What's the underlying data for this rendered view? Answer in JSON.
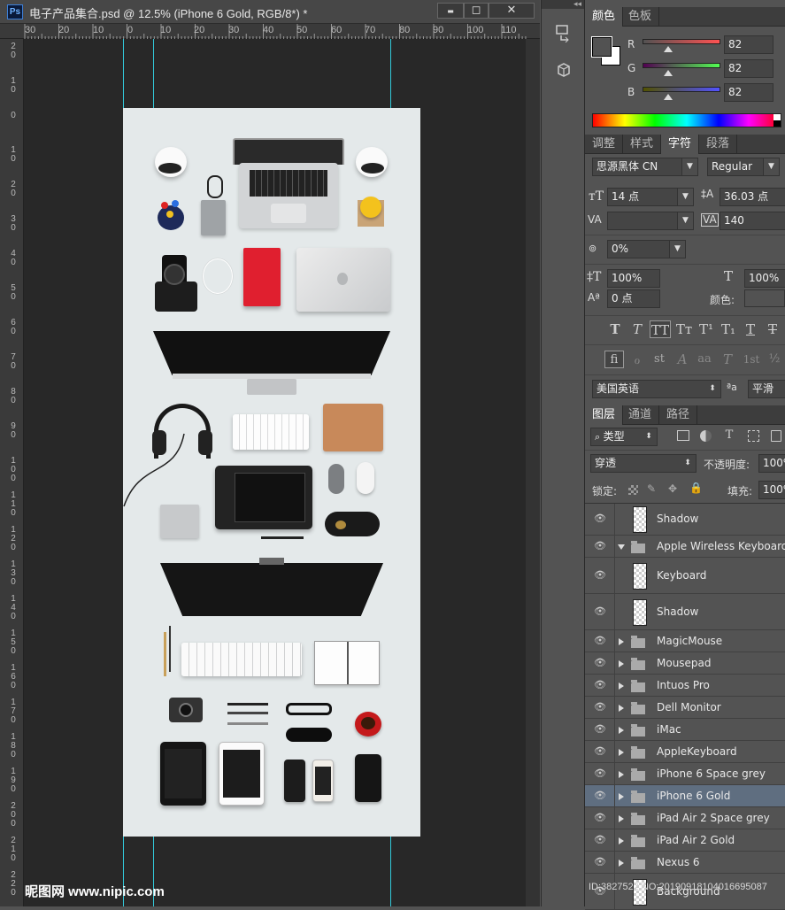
{
  "document": {
    "app_badge": "Ps",
    "title": "电子产品集合.psd @ 12.5% (iPhone 6 Gold, RGB/8*) *",
    "minimize": "▬",
    "maximize": "◻",
    "close": "✕"
  },
  "ruler_top": [
    "30",
    "20",
    "10",
    "0",
    "10",
    "20",
    "30",
    "40",
    "50",
    "60",
    "70",
    "80",
    "90",
    "100",
    "110"
  ],
  "ruler_left": [
    "20",
    "10",
    "0",
    "10",
    "20",
    "30",
    "40",
    "50",
    "60",
    "70",
    "80",
    "90",
    "100",
    "110",
    "120",
    "130",
    "140",
    "150",
    "160",
    "170",
    "180",
    "190",
    "200",
    "210",
    "220"
  ],
  "watermark": {
    "logo": "昵图网 www.nipic.com",
    "id": "ID:3827522 NO:20190918104016695087"
  },
  "color_panel": {
    "tabs": [
      "颜色",
      "色板"
    ],
    "active_tab": 0,
    "channels": [
      {
        "label": "R",
        "value": "82"
      },
      {
        "label": "G",
        "value": "82"
      },
      {
        "label": "B",
        "value": "82"
      }
    ],
    "foreground": "#525252",
    "background": "#ffffff"
  },
  "character_panel": {
    "tabs": [
      "调整",
      "样式",
      "字符",
      "段落"
    ],
    "active_tab": 2,
    "font_family": "思源黑体 CN",
    "font_style": "Regular",
    "font_size": "14 点",
    "leading": "36.03 点",
    "kerning": "",
    "tracking": "140",
    "tsume": "0%",
    "vertical_scale": "100%",
    "horizontal_scale": "100%",
    "baseline_shift": "0 点",
    "color_label": "颜色:",
    "language": "美国英语",
    "aa_label": "ªa",
    "antialias": "平滑",
    "style_buttons": [
      "T",
      "T",
      "TT",
      "Tт",
      "T¹",
      "T₁",
      "T",
      "T"
    ],
    "opentype_buttons": [
      "fi",
      "ℴ",
      "st",
      "A",
      "aa",
      "T",
      "1st",
      "½"
    ]
  },
  "layers_panel": {
    "tabs": [
      "图层",
      "通道",
      "路径"
    ],
    "active_tab": 0,
    "filter_kind": "类型",
    "blend_mode": "穿透",
    "opacity_label": "不透明度:",
    "opacity": "100%",
    "lock_label": "锁定:",
    "fill_label": "填充:",
    "fill": "100%",
    "layers": [
      {
        "name": "Shadow",
        "type": "pixel",
        "indent": 1,
        "selected": false
      },
      {
        "name": "Apple Wireless Keyboard",
        "type": "group-open",
        "indent": 0,
        "selected": false
      },
      {
        "name": "Keyboard",
        "type": "pixel",
        "indent": 1,
        "selected": false
      },
      {
        "name": "Shadow",
        "type": "pixel",
        "indent": 1,
        "selected": false
      },
      {
        "name": "MagicMouse",
        "type": "group",
        "indent": 0,
        "selected": false
      },
      {
        "name": "Mousepad",
        "type": "group",
        "indent": 0,
        "selected": false
      },
      {
        "name": "Intuos Pro",
        "type": "group",
        "indent": 0,
        "selected": false
      },
      {
        "name": "Dell Monitor",
        "type": "group",
        "indent": 0,
        "selected": false
      },
      {
        "name": "iMac",
        "type": "group",
        "indent": 0,
        "selected": false
      },
      {
        "name": "AppleKeyboard",
        "type": "group",
        "indent": 0,
        "selected": false
      },
      {
        "name": "iPhone 6 Space grey",
        "type": "group",
        "indent": 0,
        "selected": false
      },
      {
        "name": "iPhone 6 Gold",
        "type": "group",
        "indent": 0,
        "selected": true
      },
      {
        "name": "iPad Air 2 Space grey",
        "type": "group",
        "indent": 0,
        "selected": false
      },
      {
        "name": "iPad Air 2 Gold",
        "type": "group",
        "indent": 0,
        "selected": false
      },
      {
        "name": "Nexus 6",
        "type": "group",
        "indent": 0,
        "selected": false
      },
      {
        "name": "Background",
        "type": "pixel",
        "indent": 0,
        "selected": false
      }
    ]
  }
}
